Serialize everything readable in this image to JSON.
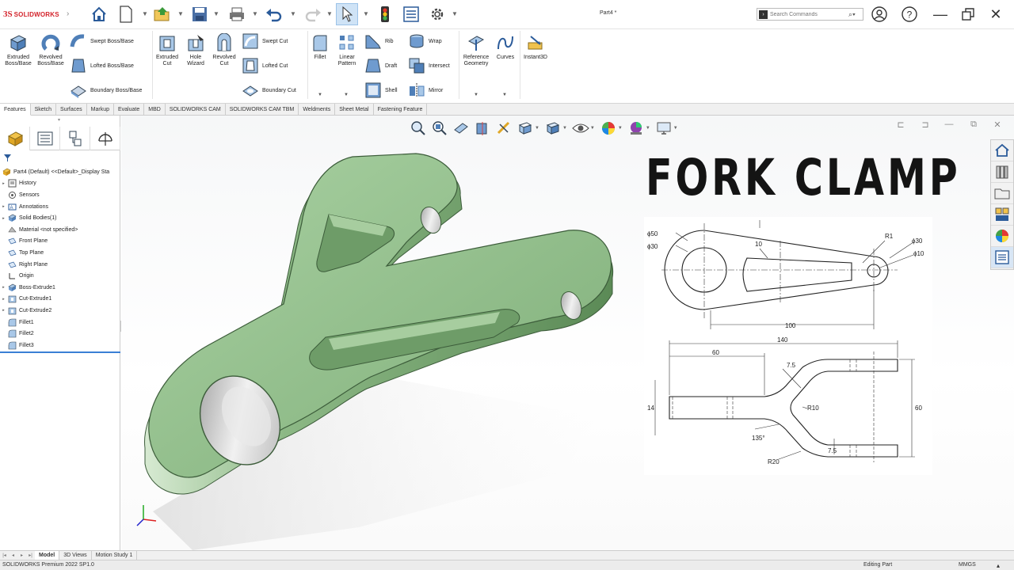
{
  "app": {
    "brand": "SOLIDWORKS",
    "document_title": "Part4 *",
    "search_placeholder": "Search Commands"
  },
  "ribbon": {
    "extruded_boss": "Extruded Boss/Base",
    "revolved_boss": "Revolved Boss/Base",
    "swept_boss": "Swept Boss/Base",
    "lofted_boss": "Lofted Boss/Base",
    "boundary_boss": "Boundary Boss/Base",
    "extruded_cut": "Extruded Cut",
    "hole_wizard": "Hole Wizard",
    "revolved_cut": "Revolved Cut",
    "swept_cut": "Swept Cut",
    "lofted_cut": "Lofted Cut",
    "boundary_cut": "Boundary Cut",
    "fillet": "Fillet",
    "linear_pattern": "Linear Pattern",
    "rib": "Rib",
    "draft": "Draft",
    "shell": "Shell",
    "wrap": "Wrap",
    "intersect": "Intersect",
    "mirror": "Mirror",
    "reference_geometry": "Reference Geometry",
    "curves": "Curves",
    "instant3d": "Instant3D"
  },
  "command_tabs": [
    "Features",
    "Sketch",
    "Surfaces",
    "Markup",
    "Evaluate",
    "MBD",
    "SOLIDWORKS CAM",
    "SOLIDWORKS CAM TBM",
    "Weldments",
    "Sheet Metal",
    "Fastening Feature"
  ],
  "feature_tree": {
    "root": "Part4 (Default) <<Default>_Display Sta",
    "items": [
      {
        "label": "History",
        "icon": "history-icon",
        "expandable": true
      },
      {
        "label": "Sensors",
        "icon": "sensors-icon",
        "expandable": false
      },
      {
        "label": "Annotations",
        "icon": "annotations-icon",
        "expandable": true
      },
      {
        "label": "Solid Bodies(1)",
        "icon": "solid-bodies-icon",
        "expandable": true
      },
      {
        "label": "Material <not specified>",
        "icon": "material-icon",
        "expandable": false
      },
      {
        "label": "Front Plane",
        "icon": "plane-icon",
        "expandable": false
      },
      {
        "label": "Top Plane",
        "icon": "plane-icon",
        "expandable": false
      },
      {
        "label": "Right Plane",
        "icon": "plane-icon",
        "expandable": false
      },
      {
        "label": "Origin",
        "icon": "origin-icon",
        "expandable": false
      },
      {
        "label": "Boss-Extrude1",
        "icon": "boss-extrude-icon",
        "expandable": true
      },
      {
        "label": "Cut-Extrude1",
        "icon": "cut-extrude-icon",
        "expandable": true
      },
      {
        "label": "Cut-Extrude2",
        "icon": "cut-extrude-icon",
        "expandable": true
      },
      {
        "label": "Fillet1",
        "icon": "fillet-icon",
        "expandable": false
      },
      {
        "label": "Fillet2",
        "icon": "fillet-icon",
        "expandable": false
      },
      {
        "label": "Fillet3",
        "icon": "fillet-icon",
        "expandable": false
      }
    ]
  },
  "overlay": {
    "title": "FORK CLAMP"
  },
  "drawing_dims": {
    "d50": "ϕ50",
    "d30a": "ϕ30",
    "d10_top": "10",
    "r1": "R1",
    "d30b": "ϕ30",
    "d10": "ϕ10",
    "d100": "100",
    "d140": "140",
    "d60a": "60",
    "d75a": "7.5",
    "d14": "14",
    "r10": "R10",
    "d60b": "60",
    "a135": "135°",
    "r20": "R20",
    "d75b": "7.5"
  },
  "bottom_tabs": [
    "Model",
    "3D Views",
    "Motion Study 1"
  ],
  "status": {
    "version": "SOLIDWORKS Premium 2022 SP1.0",
    "mode": "Editing Part",
    "units": "MMGS"
  },
  "colors": {
    "part_green": "#8fbf8a",
    "brand_red": "#d3222a",
    "selection_blue": "#3a7fd5"
  }
}
